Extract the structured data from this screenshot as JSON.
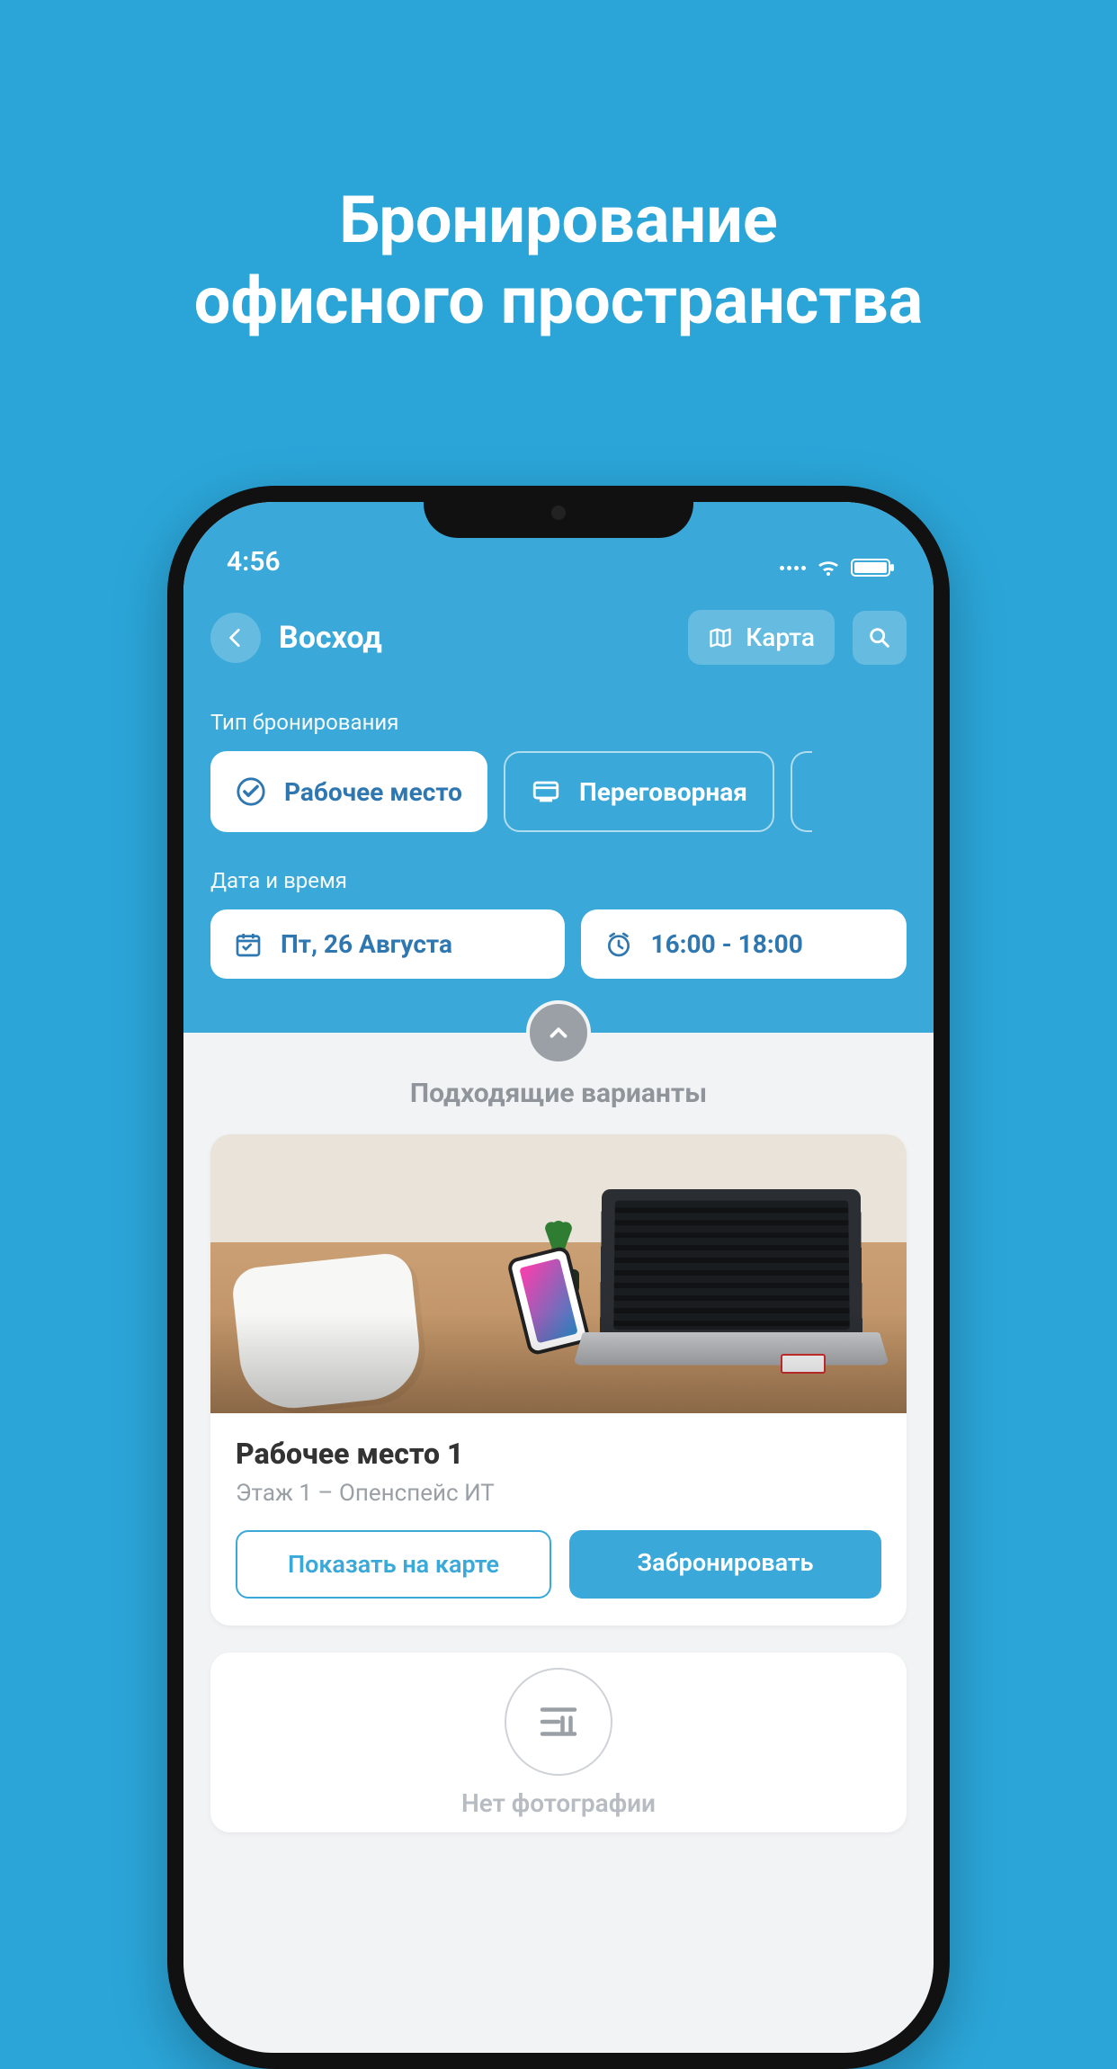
{
  "marketing": {
    "title_line1": "Бронирование",
    "title_line2": "офисного пространства"
  },
  "status": {
    "time": "4:56"
  },
  "header": {
    "title": "Восход",
    "map_label": "Карта"
  },
  "booking_type": {
    "section_label": "Тип бронирования",
    "workplace": "Рабочее место",
    "meeting_room": "Переговорная"
  },
  "datetime": {
    "section_label": "Дата и время",
    "date": "Пт, 26 Августа",
    "time": "16:00 - 18:00"
  },
  "results": {
    "label": "Подходящие варианты",
    "card1": {
      "title": "Рабочее место 1",
      "floor": "Этаж 1",
      "separator": " – ",
      "zone": "Опенспейс ИТ",
      "show_on_map": "Показать на карте",
      "book": "Забронировать"
    },
    "placeholder_label": "Нет фотографии"
  },
  "colors": {
    "brand_blue": "#3aa8d8",
    "bg_blue": "#2ba5d8",
    "text_blue": "#2f77b0",
    "grey": "#9aa0a6"
  }
}
